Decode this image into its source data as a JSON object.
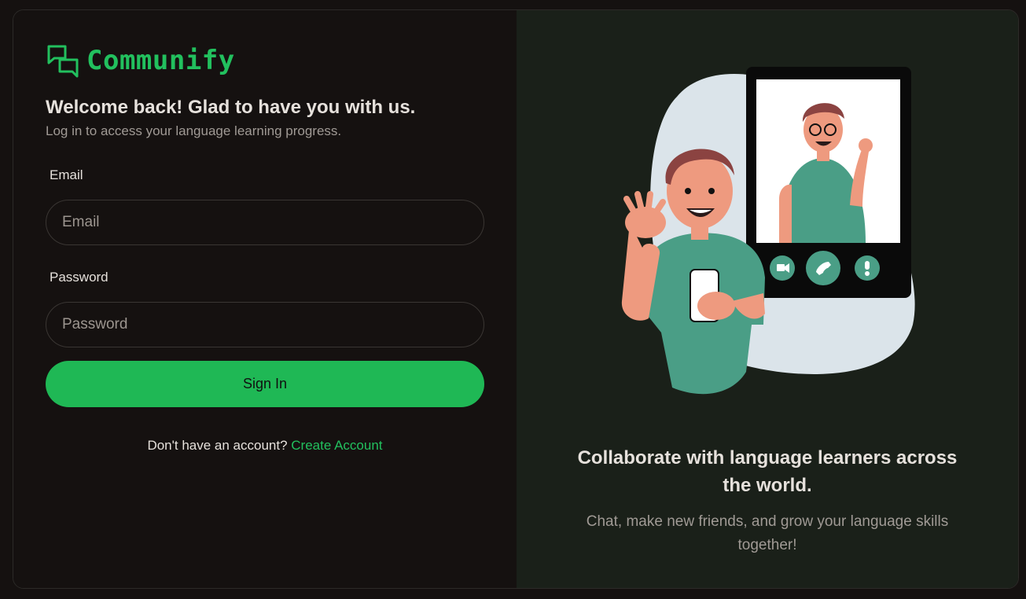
{
  "brand": {
    "name": "Communify",
    "accent_color": "#22c05e",
    "logo_icon": "chat-bubbles-icon"
  },
  "login": {
    "heading": "Welcome back! Glad to have you with us.",
    "subheading": "Log in to access your language learning progress.",
    "email_label": "Email",
    "email_placeholder": "Email",
    "email_value": "",
    "password_label": "Password",
    "password_placeholder": "Password",
    "password_value": "",
    "submit_label": "Sign In",
    "signup_prompt": "Don't have an account?",
    "signup_link": "Create Account"
  },
  "promo": {
    "illustration": "video-call-illustration",
    "call_controls": [
      "video-icon",
      "phone-icon",
      "alert-icon"
    ],
    "title": "Collaborate with language learners across the world.",
    "description": "Chat, make new friends, and grow your language skills together!"
  }
}
